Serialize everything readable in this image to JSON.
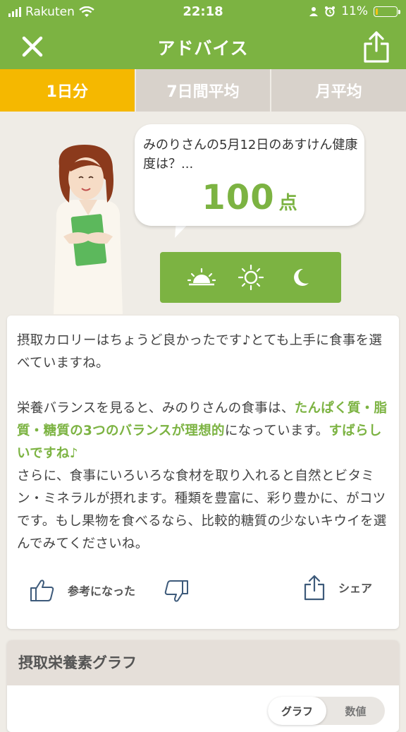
{
  "status": {
    "carrier": "Rakuten",
    "time": "22:18",
    "battery": "11%",
    "battery_level": 0.11
  },
  "nav": {
    "title": "アドバイス"
  },
  "tabs": [
    "1日分",
    "7日間平均",
    "月平均"
  ],
  "advice": {
    "question": "みのりさんの5月12日のあすけん健康度は？...",
    "score": "100",
    "score_unit": "点",
    "meals": [
      "morning-icon",
      "noon-icon",
      "night-icon"
    ]
  },
  "message": {
    "p1": "摂取カロリーはちょうど良かったです♪とても上手に食事を選べていますね。",
    "p2a": "栄養バランスを見ると、みのりさんの食事は、",
    "p2b": "たんぱく質・脂質・糖質の3つのバランスが理想的",
    "p2c": "になっています。",
    "p2d": "すばらしいですね♪",
    "p3": "さらに、食事にいろいろな食材を取り入れると自然とビタミン・ミネラルが摂れます。種類を豊富に、彩り豊かに、がコツです。もし果物を食べるなら、比較的糖質の少ないキウイを選んでみてくださいね。"
  },
  "actions": {
    "helpful": "参考になった",
    "share": "シェア"
  },
  "nutrient": {
    "title": "摂取栄養素グラフ",
    "toggle": [
      "グラフ",
      "数値"
    ]
  },
  "colors": {
    "brand_green": "#7cb342",
    "tab_active": "#f5b800",
    "tab_inactive": "#d8d2cb"
  }
}
